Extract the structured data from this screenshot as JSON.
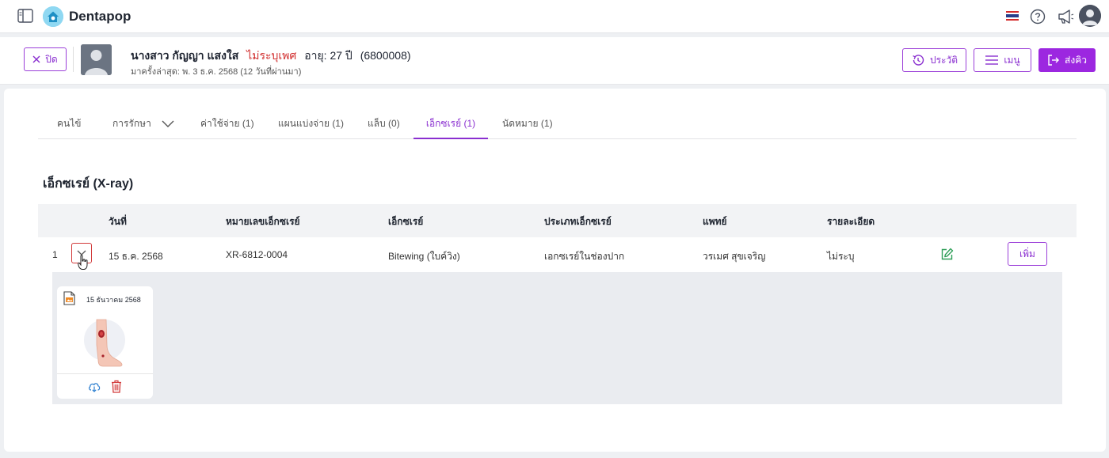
{
  "app": {
    "brand": "Dentapop"
  },
  "colors": {
    "accent": "#9c27e0",
    "accent_border": "#9b3fd8",
    "gender_red": "#d12d2d",
    "table_head_bg": "#f2f3f5",
    "panel_bg": "#eaecf0"
  },
  "icons": {
    "sidebar": "sidebar-toggle-icon",
    "logo": "home-logo-icon",
    "flag": "thai-flag-icon",
    "help": "help-icon",
    "announce": "megaphone-icon",
    "avatar": "user-avatar-icon"
  },
  "patient": {
    "name": "นางสาว กัญญา แสงใส",
    "gender": "ไม่ระบุเพศ",
    "age_label": "อายุ: 27 ปี",
    "hn": "(6800008)",
    "last_visit": "มาครั้งล่าสุด: พ. 3 ธ.ค. 2568 (12 วันที่ผ่านมา)"
  },
  "actions": {
    "close": "ปิด",
    "history": "ประวัติ",
    "menu": "เมนู",
    "send_queue": "ส่งคิว"
  },
  "tabs": [
    {
      "label": "คนไข้"
    },
    {
      "label": "การรักษา"
    },
    {
      "label": "ค่าใช้จ่าย (1)"
    },
    {
      "label": "แผนแบ่งจ่าย (1)"
    },
    {
      "label": "แล็บ (0)"
    },
    {
      "label": "เอ็กซเรย์ (1)"
    },
    {
      "label": "นัดหมาย (1)"
    }
  ],
  "active_tab": "เอ็กซเรย์ (1)",
  "section": {
    "title": "เอ็กซเรย์ (X-ray)"
  },
  "table": {
    "headers": [
      "วันที่",
      "หมายเลขเอ็กซเรย์",
      "เอ็กซเรย์",
      "ประเภทเอ็กซเรย์",
      "แพทย์",
      "รายละเอียด"
    ],
    "rows": [
      {
        "index": "1",
        "date": "15 ธ.ค. 2568",
        "xray_number": "XR-6812-0004",
        "xray": "Bitewing (ใบค์วิง)",
        "xray_type": "เอกซเรย์ในช่องปาก",
        "doctor": "วรเมศ สุขเจริญ",
        "detail": "ไม่ระบุ",
        "add_label": "เพิ่ม"
      }
    ]
  },
  "xray_files": [
    {
      "date": "15 ธันวาคม 2568"
    }
  ]
}
